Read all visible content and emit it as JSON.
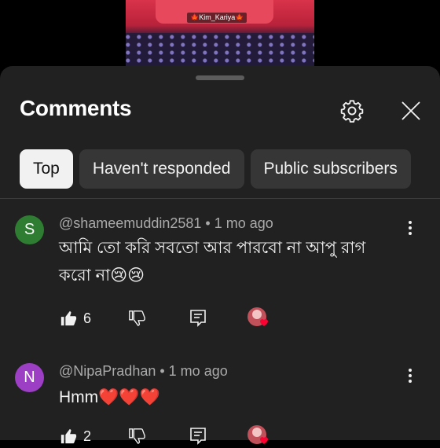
{
  "video": {
    "watermark": "Kim_Kariya"
  },
  "sheet": {
    "title": "Comments",
    "chips": [
      {
        "label": "Top",
        "active": true
      },
      {
        "label": "Haven't responded",
        "active": false
      },
      {
        "label": "Public subscribers",
        "active": false
      }
    ]
  },
  "comments": [
    {
      "avatar_letter": "S",
      "avatar_color": "#2e7d32",
      "author": "@shameemuddin2581",
      "time": "1 mo ago",
      "text_line1": "আমি তো করি সবতো আর পারবো না আপু রাগ",
      "text_line2": "করো না😢😢",
      "likes": "6"
    },
    {
      "avatar_letter": "N",
      "avatar_color": "#9c3fc4",
      "author": "@NipaPradhan",
      "time": "1 mo ago",
      "text_line1": "Hmm❤️❤️❤️",
      "likes": "2"
    }
  ],
  "colors": {
    "sheet_bg": "#212121",
    "chip_bg": "#363636",
    "chip_active_bg": "#f1f1f1",
    "meta_text": "#aaaaaa"
  }
}
